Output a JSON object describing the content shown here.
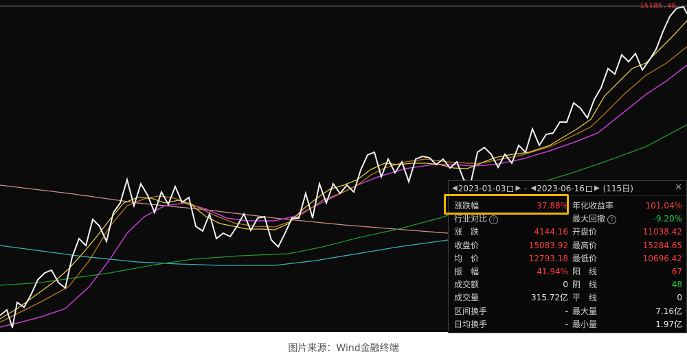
{
  "price_label": "15185.48",
  "panel": {
    "start_date": "2023-01-03",
    "end_date": "2023-06-16",
    "days": "(115日)",
    "dash": "-",
    "close_icon": "close-icon",
    "left_rows": [
      {
        "label": "涨跌幅",
        "value": "37.88%",
        "color": "#ff3b3b"
      },
      {
        "label": "行业对比",
        "value": "",
        "color": "#e6e6e6"
      },
      {
        "label": "涨　跌",
        "value": "4144.16",
        "color": "#ff3b3b"
      },
      {
        "label": "收盘价",
        "value": "15083.92",
        "color": "#ff3b3b"
      },
      {
        "label": "均　价",
        "value": "12793.18",
        "color": "#ff3b3b"
      },
      {
        "label": "振　幅",
        "value": "41.94%",
        "color": "#ff3b3b"
      },
      {
        "label": "成交额",
        "value": "0",
        "color": "#e6e6e6"
      },
      {
        "label": "成交量",
        "value": "315.72亿",
        "color": "#e6e6e6"
      },
      {
        "label": "区间换手",
        "value": "-",
        "color": "#e6e6e6"
      },
      {
        "label": "日均换手",
        "value": "-",
        "color": "#e6e6e6"
      }
    ],
    "right_rows": [
      {
        "label": "年化收益率",
        "value": "101.04%",
        "color": "#ff3b3b"
      },
      {
        "label": "最大回撤",
        "value": "-9.20%",
        "color": "#29d04a"
      },
      {
        "label": "开盘价",
        "value": "11038.42",
        "color": "#ff3b3b"
      },
      {
        "label": "最高价",
        "value": "15284.65",
        "color": "#ff3b3b"
      },
      {
        "label": "最低价",
        "value": "10696.42",
        "color": "#ff3b3b"
      },
      {
        "label": "阳　线",
        "value": "67",
        "color": "#ff3b3b"
      },
      {
        "label": "阴　线",
        "value": "48",
        "color": "#29d04a"
      },
      {
        "label": "平　线",
        "value": "0",
        "color": "#e6e6e6"
      },
      {
        "label": "最大量",
        "value": "7.16亿",
        "color": "#e6e6e6"
      },
      {
        "label": "最小量",
        "value": "1.97亿",
        "color": "#e6e6e6"
      }
    ]
  },
  "caption": "图片来源：Wind金融终端",
  "colors": {
    "price": "#f2f2f2",
    "ma_short": "#e3c84a",
    "ma_mid": "#b8791c",
    "ma_long": "#c23fd0",
    "ma_green": "#1f9a2c",
    "ma_cyan": "#36b3b8",
    "ma_pink": "#d48e8e",
    "highlight": "#f0b400"
  }
}
